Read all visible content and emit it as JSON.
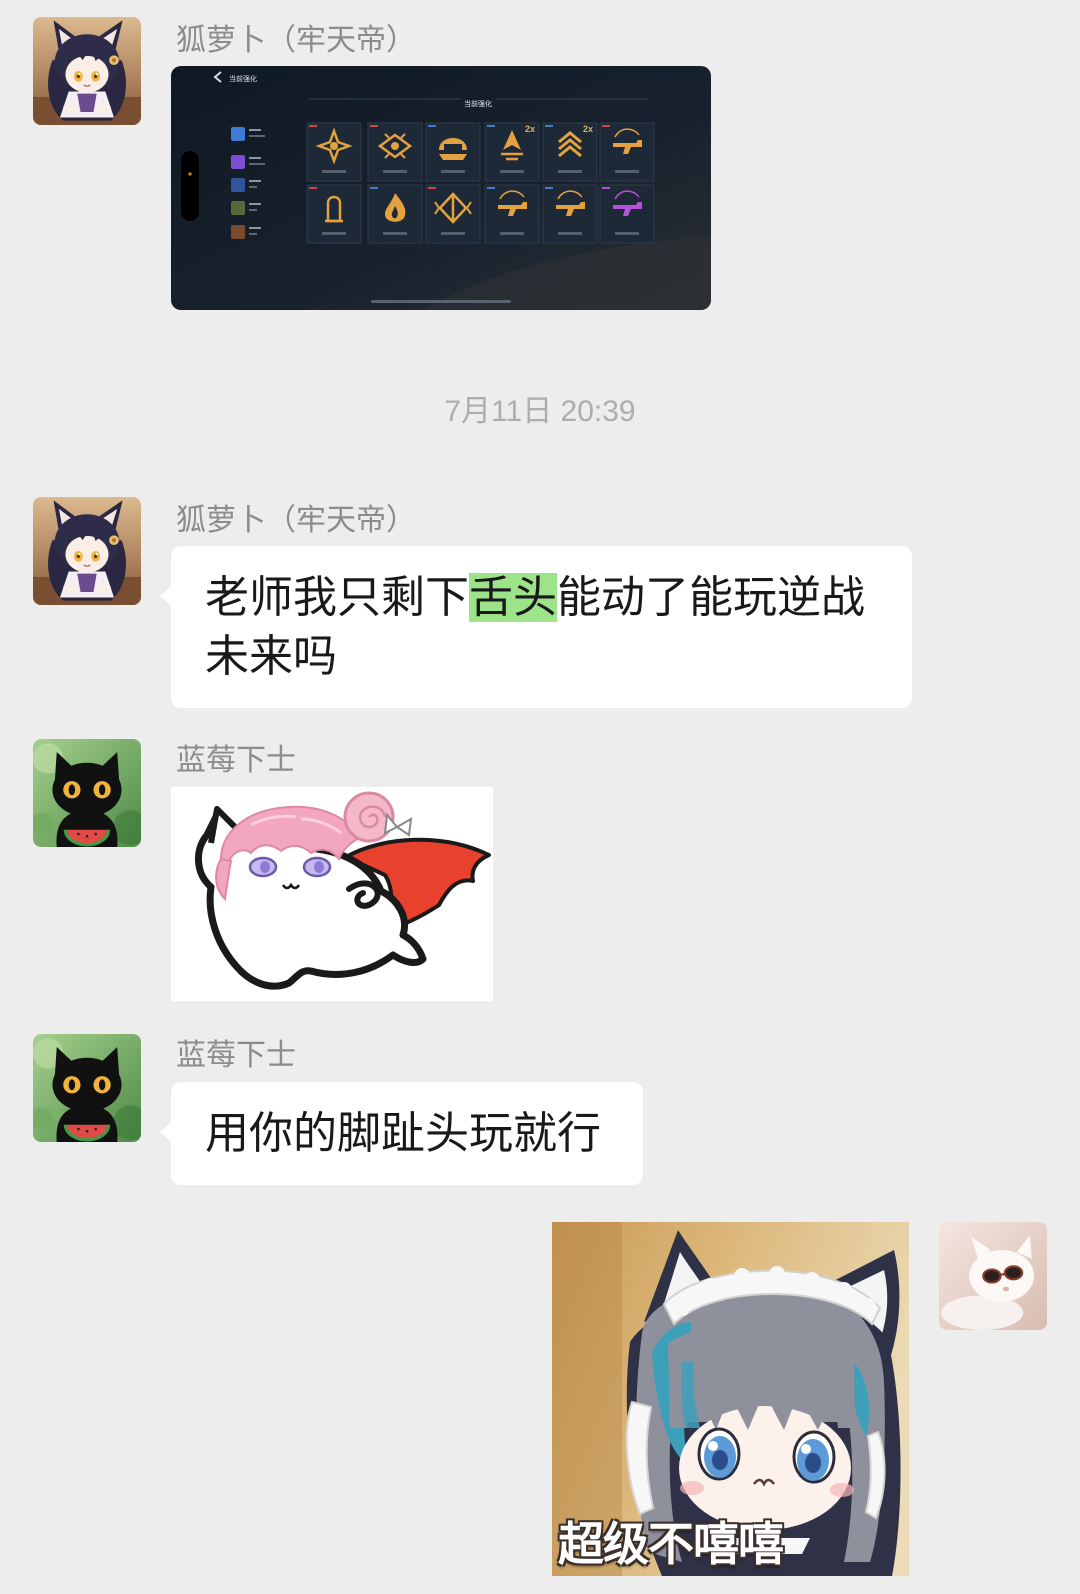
{
  "colors": {
    "page_background": "#EDEDED",
    "bubble_background": "#FFFFFF",
    "highlight": "#9DE38A",
    "sender_name": "#8C8C8C",
    "timestamp": "#ADADAD",
    "message_text": "#191919",
    "game_gold": "#E3A23F",
    "game_purple": "#B552DB"
  },
  "timestamp": "7月11日 20:39",
  "messages": [
    {
      "sender": "狐萝卜（牢天帝）",
      "avatar_icon": "fox-girl-avatar",
      "image": {
        "back_icon": "chevron-left-icon",
        "top_title": "当前强化",
        "section_title": "当前强化",
        "multiplier_badges": [
          "2x",
          "2x"
        ],
        "enhancement_icons": [
          "starburst-icon",
          "diamond-eye-icon",
          "helmet-icon",
          "spike-icon",
          "chevron-stack-icon",
          "rifle-icon",
          "bullet-icon",
          "flame-icon",
          "split-diamond-icon",
          "rifle-icon",
          "rifle-icon",
          "rifle-icon"
        ]
      }
    },
    {
      "sender": "狐萝卜（牢天帝）",
      "avatar_icon": "fox-girl-avatar",
      "text_before": "老师我只剩下",
      "text_highlight": "舌头",
      "text_after": "能动了能玩逆战未来吗"
    },
    {
      "sender": "蓝莓下士",
      "avatar_icon": "black-cat-avatar",
      "sticker_icon": "pink-hair-cat-sticker"
    },
    {
      "sender": "蓝莓下士",
      "avatar_icon": "black-cat-avatar",
      "text": "用你的脚趾头玩就行"
    },
    {
      "outgoing": true,
      "avatar_icon": "white-cat-sunglasses-avatar",
      "sticker_icon": "maid-girl-sticker",
      "sticker_caption": "超级不嘻嘻"
    }
  ]
}
